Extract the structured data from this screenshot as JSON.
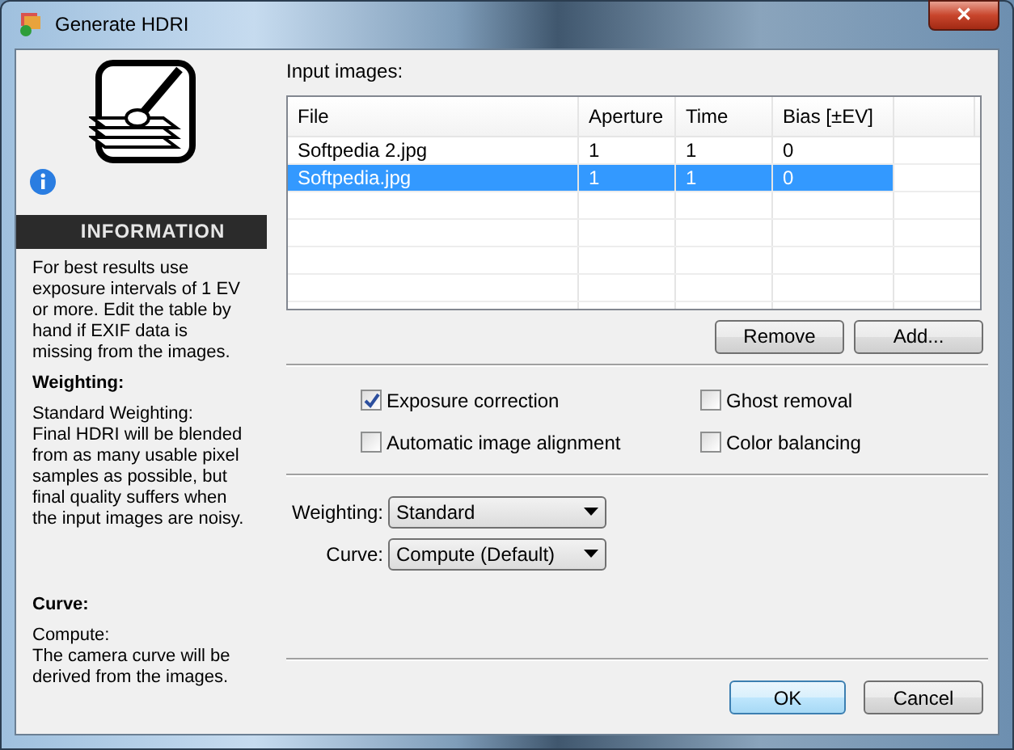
{
  "window": {
    "title": "Generate HDRI",
    "close": "✕"
  },
  "info_panel": {
    "heading": "INFORMATION",
    "intro": "For best results use exposure intervals of 1 EV or more. Edit the table by hand if EXIF data is missing from the images.",
    "sections": [
      {
        "title": "Weighting:",
        "lines": [
          "Standard Weighting:",
          "Final HDRI will be blended from as many usable pixel samples as possible, but final quality suffers when the input images are noisy."
        ]
      },
      {
        "title": "Curve:",
        "lines": [
          "Compute:",
          "The camera curve will be derived from the images."
        ]
      }
    ]
  },
  "input_images": {
    "label": "Input images:",
    "columns": [
      "File",
      "Aperture",
      "Time",
      "Bias [±EV]"
    ],
    "rows": [
      {
        "cells": [
          "Softpedia 2.jpg",
          "1",
          "1",
          "0"
        ],
        "selected": false
      },
      {
        "cells": [
          "Softpedia.jpg",
          "1",
          "1",
          "0"
        ],
        "selected": true
      }
    ],
    "buttons": [
      "Remove",
      "Add..."
    ]
  },
  "options": [
    {
      "label": "Exposure correction",
      "checked": true
    },
    {
      "label": "Ghost removal",
      "checked": false
    },
    {
      "label": "Automatic image alignment",
      "checked": false
    },
    {
      "label": "Color balancing",
      "checked": false
    }
  ],
  "dropdowns": [
    {
      "label": "Weighting:",
      "value": "Standard"
    },
    {
      "label": "Curve:",
      "value": "Compute  (Default)"
    }
  ],
  "dialog_buttons": [
    {
      "label": "OK",
      "default": true
    },
    {
      "label": "Cancel",
      "default": false
    }
  ]
}
